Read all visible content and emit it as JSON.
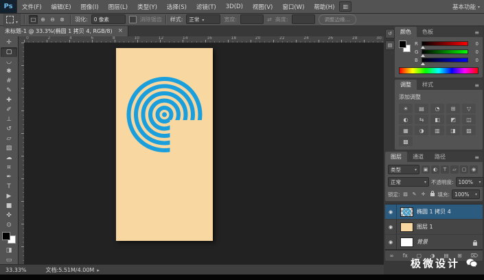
{
  "app": {
    "logo_text": "Ps",
    "workspace_button": "基本功能"
  },
  "menu_items": [
    "文件(F)",
    "编辑(E)",
    "图像(I)",
    "图层(L)",
    "类型(Y)",
    "选择(S)",
    "滤镜(T)",
    "3D(D)",
    "视图(V)",
    "窗口(W)",
    "帮助(H)"
  ],
  "options_bar": {
    "selection_modes": [
      {
        "name": "new-selection",
        "glyph": "□"
      },
      {
        "name": "add-to-selection",
        "glyph": "⊕"
      },
      {
        "name": "subtract-from-selection",
        "glyph": "⊖"
      },
      {
        "name": "intersect-selection",
        "glyph": "⊗"
      }
    ],
    "feather_label": "羽化:",
    "feather_value": "0 像素",
    "antialias_label": "消除锯齿",
    "style_label": "样式:",
    "style_value": "正常",
    "width_label": "宽度:",
    "swap_icon": "⇄",
    "height_label": "高度:",
    "refine_edge_label": "调整边缘…"
  },
  "document_tab": {
    "title": "未标题-1 @ 33.3%(椭圆 1 拷贝 4, RGB/8)",
    "close_glyph": "×"
  },
  "ruler_numbers": [
    "0",
    "2",
    "4",
    "6",
    "8",
    "10",
    "12",
    "14",
    "16",
    "18",
    "20",
    "22",
    "24",
    "26",
    "28",
    "30"
  ],
  "tools": [
    {
      "name": "move-tool",
      "glyph": "✛"
    },
    {
      "name": "rectangular-marquee-tool",
      "glyph": "▢",
      "active": true
    },
    {
      "name": "lasso-tool",
      "glyph": "◡"
    },
    {
      "name": "quick-selection-tool",
      "glyph": "✱"
    },
    {
      "name": "crop-tool",
      "glyph": "#"
    },
    {
      "name": "eyedropper-tool",
      "glyph": "✎"
    },
    {
      "name": "spot-healing-brush-tool",
      "glyph": "✚"
    },
    {
      "name": "brush-tool",
      "glyph": "✐"
    },
    {
      "name": "clone-stamp-tool",
      "glyph": "⊥"
    },
    {
      "name": "history-brush-tool",
      "glyph": "↺"
    },
    {
      "name": "eraser-tool",
      "glyph": "▱"
    },
    {
      "name": "gradient-tool",
      "glyph": "▧"
    },
    {
      "name": "blur-tool",
      "glyph": "☁"
    },
    {
      "name": "dodge-tool",
      "glyph": "¤"
    },
    {
      "name": "pen-tool",
      "glyph": "✒"
    },
    {
      "name": "type-tool",
      "glyph": "T"
    },
    {
      "name": "path-selection-tool",
      "glyph": "▶"
    },
    {
      "name": "rectangle-tool",
      "glyph": "■"
    },
    {
      "name": "hand-tool",
      "glyph": "✜"
    },
    {
      "name": "zoom-tool",
      "glyph": "⊙"
    }
  ],
  "tool_extras": [
    {
      "name": "quick-mask-icon",
      "glyph": "◨"
    },
    {
      "name": "screen-mode-icon",
      "glyph": "▭"
    }
  ],
  "panels": {
    "collapsed_dock": [
      {
        "name": "history-panel-icon",
        "glyph": "↺"
      },
      {
        "name": "properties-panel-icon",
        "glyph": "▤"
      }
    ],
    "color": {
      "tab_active": "颜色",
      "tab_inactive": "色板",
      "channels": [
        {
          "label": "R",
          "value": "0",
          "to": "#FF0000"
        },
        {
          "label": "G",
          "value": "0",
          "to": "#00FF00"
        },
        {
          "label": "B",
          "value": "0",
          "to": "#0000FF"
        }
      ]
    },
    "adjustments": {
      "tab_active": "调整",
      "tab_inactive": "样式",
      "title": "添加调整",
      "icons": [
        {
          "name": "brightness-contrast-icon",
          "glyph": "☀"
        },
        {
          "name": "levels-icon",
          "glyph": "▤"
        },
        {
          "name": "curves-icon",
          "glyph": "◔"
        },
        {
          "name": "exposure-icon",
          "glyph": "⊞"
        },
        {
          "name": "vibrance-icon",
          "glyph": "▽"
        },
        {
          "name": "hue-saturation-icon",
          "glyph": "◐"
        },
        {
          "name": "color-balance-icon",
          "glyph": "⇆"
        },
        {
          "name": "black-white-icon",
          "glyph": "◧"
        },
        {
          "name": "photo-filter-icon",
          "glyph": "◩"
        },
        {
          "name": "channel-mixer-icon",
          "glyph": "◫"
        },
        {
          "name": "color-lookup-icon",
          "glyph": "▦"
        },
        {
          "name": "invert-icon",
          "glyph": "◑"
        },
        {
          "name": "posterize-icon",
          "glyph": "▥"
        },
        {
          "name": "threshold-icon",
          "glyph": "◨"
        },
        {
          "name": "gradient-map-icon",
          "glyph": "▨"
        },
        {
          "name": "selective-color-icon",
          "glyph": "▩"
        }
      ]
    },
    "layers": {
      "tabs": [
        {
          "label": "图层",
          "active": true
        },
        {
          "label": "通道"
        },
        {
          "label": "路径"
        }
      ],
      "filter_label": "类型",
      "filter_icons": [
        {
          "name": "filter-pixel-layers-icon",
          "glyph": "▣"
        },
        {
          "name": "filter-adjustment-layers-icon",
          "glyph": "◐"
        },
        {
          "name": "filter-type-layers-icon",
          "glyph": "T"
        },
        {
          "name": "filter-shape-layers-icon",
          "glyph": "▱"
        },
        {
          "name": "filter-smart-objects-icon",
          "glyph": "▢"
        },
        {
          "name": "layer-filter-toggle-icon",
          "glyph": "◉"
        }
      ],
      "blend_mode": "正常",
      "opacity_label": "不透明度:",
      "opacity_value": "100%",
      "lock_label": "锁定:",
      "lock_icons": [
        {
          "name": "lock-transparency-icon",
          "glyph": "▨"
        },
        {
          "name": "lock-pixels-icon",
          "glyph": "✎"
        },
        {
          "name": "lock-position-icon",
          "glyph": "✛"
        },
        {
          "name": "lock-all-icon",
          "lock": true
        }
      ],
      "fill_label": "填充:",
      "fill_value": "100%",
      "eye_glyph": "◉",
      "rows": [
        {
          "name": "椭圆 1 拷贝 4",
          "thumb": "rings",
          "selected": true
        },
        {
          "name": "图层 1",
          "thumb": "peach"
        },
        {
          "name": "背景",
          "thumb": "white",
          "locked": true,
          "italic": true
        }
      ],
      "bottom_icons": [
        {
          "name": "link-layers-icon",
          "glyph": "∞"
        },
        {
          "name": "layer-style-icon",
          "glyph": "fx"
        },
        {
          "name": "add-layer-mask-icon",
          "glyph": "▢"
        },
        {
          "name": "new-adjustment-layer-icon",
          "glyph": "◑"
        },
        {
          "name": "new-group-icon",
          "glyph": "▤"
        },
        {
          "name": "new-layer-icon",
          "glyph": "⊞"
        },
        {
          "name": "delete-layer-icon",
          "glyph": "⌦"
        }
      ]
    }
  },
  "status_bar": {
    "zoom": "33.33%",
    "doc_label": "文档:5.51M/4.00M"
  },
  "watermark": {
    "text": "极微设计"
  },
  "colors": {
    "doc_color": "#F8D8A0",
    "logo_blue": "#1B9FDC",
    "selection_blue": "#2B5C80",
    "foreground": "#000000",
    "background": "#FFFFFF"
  }
}
